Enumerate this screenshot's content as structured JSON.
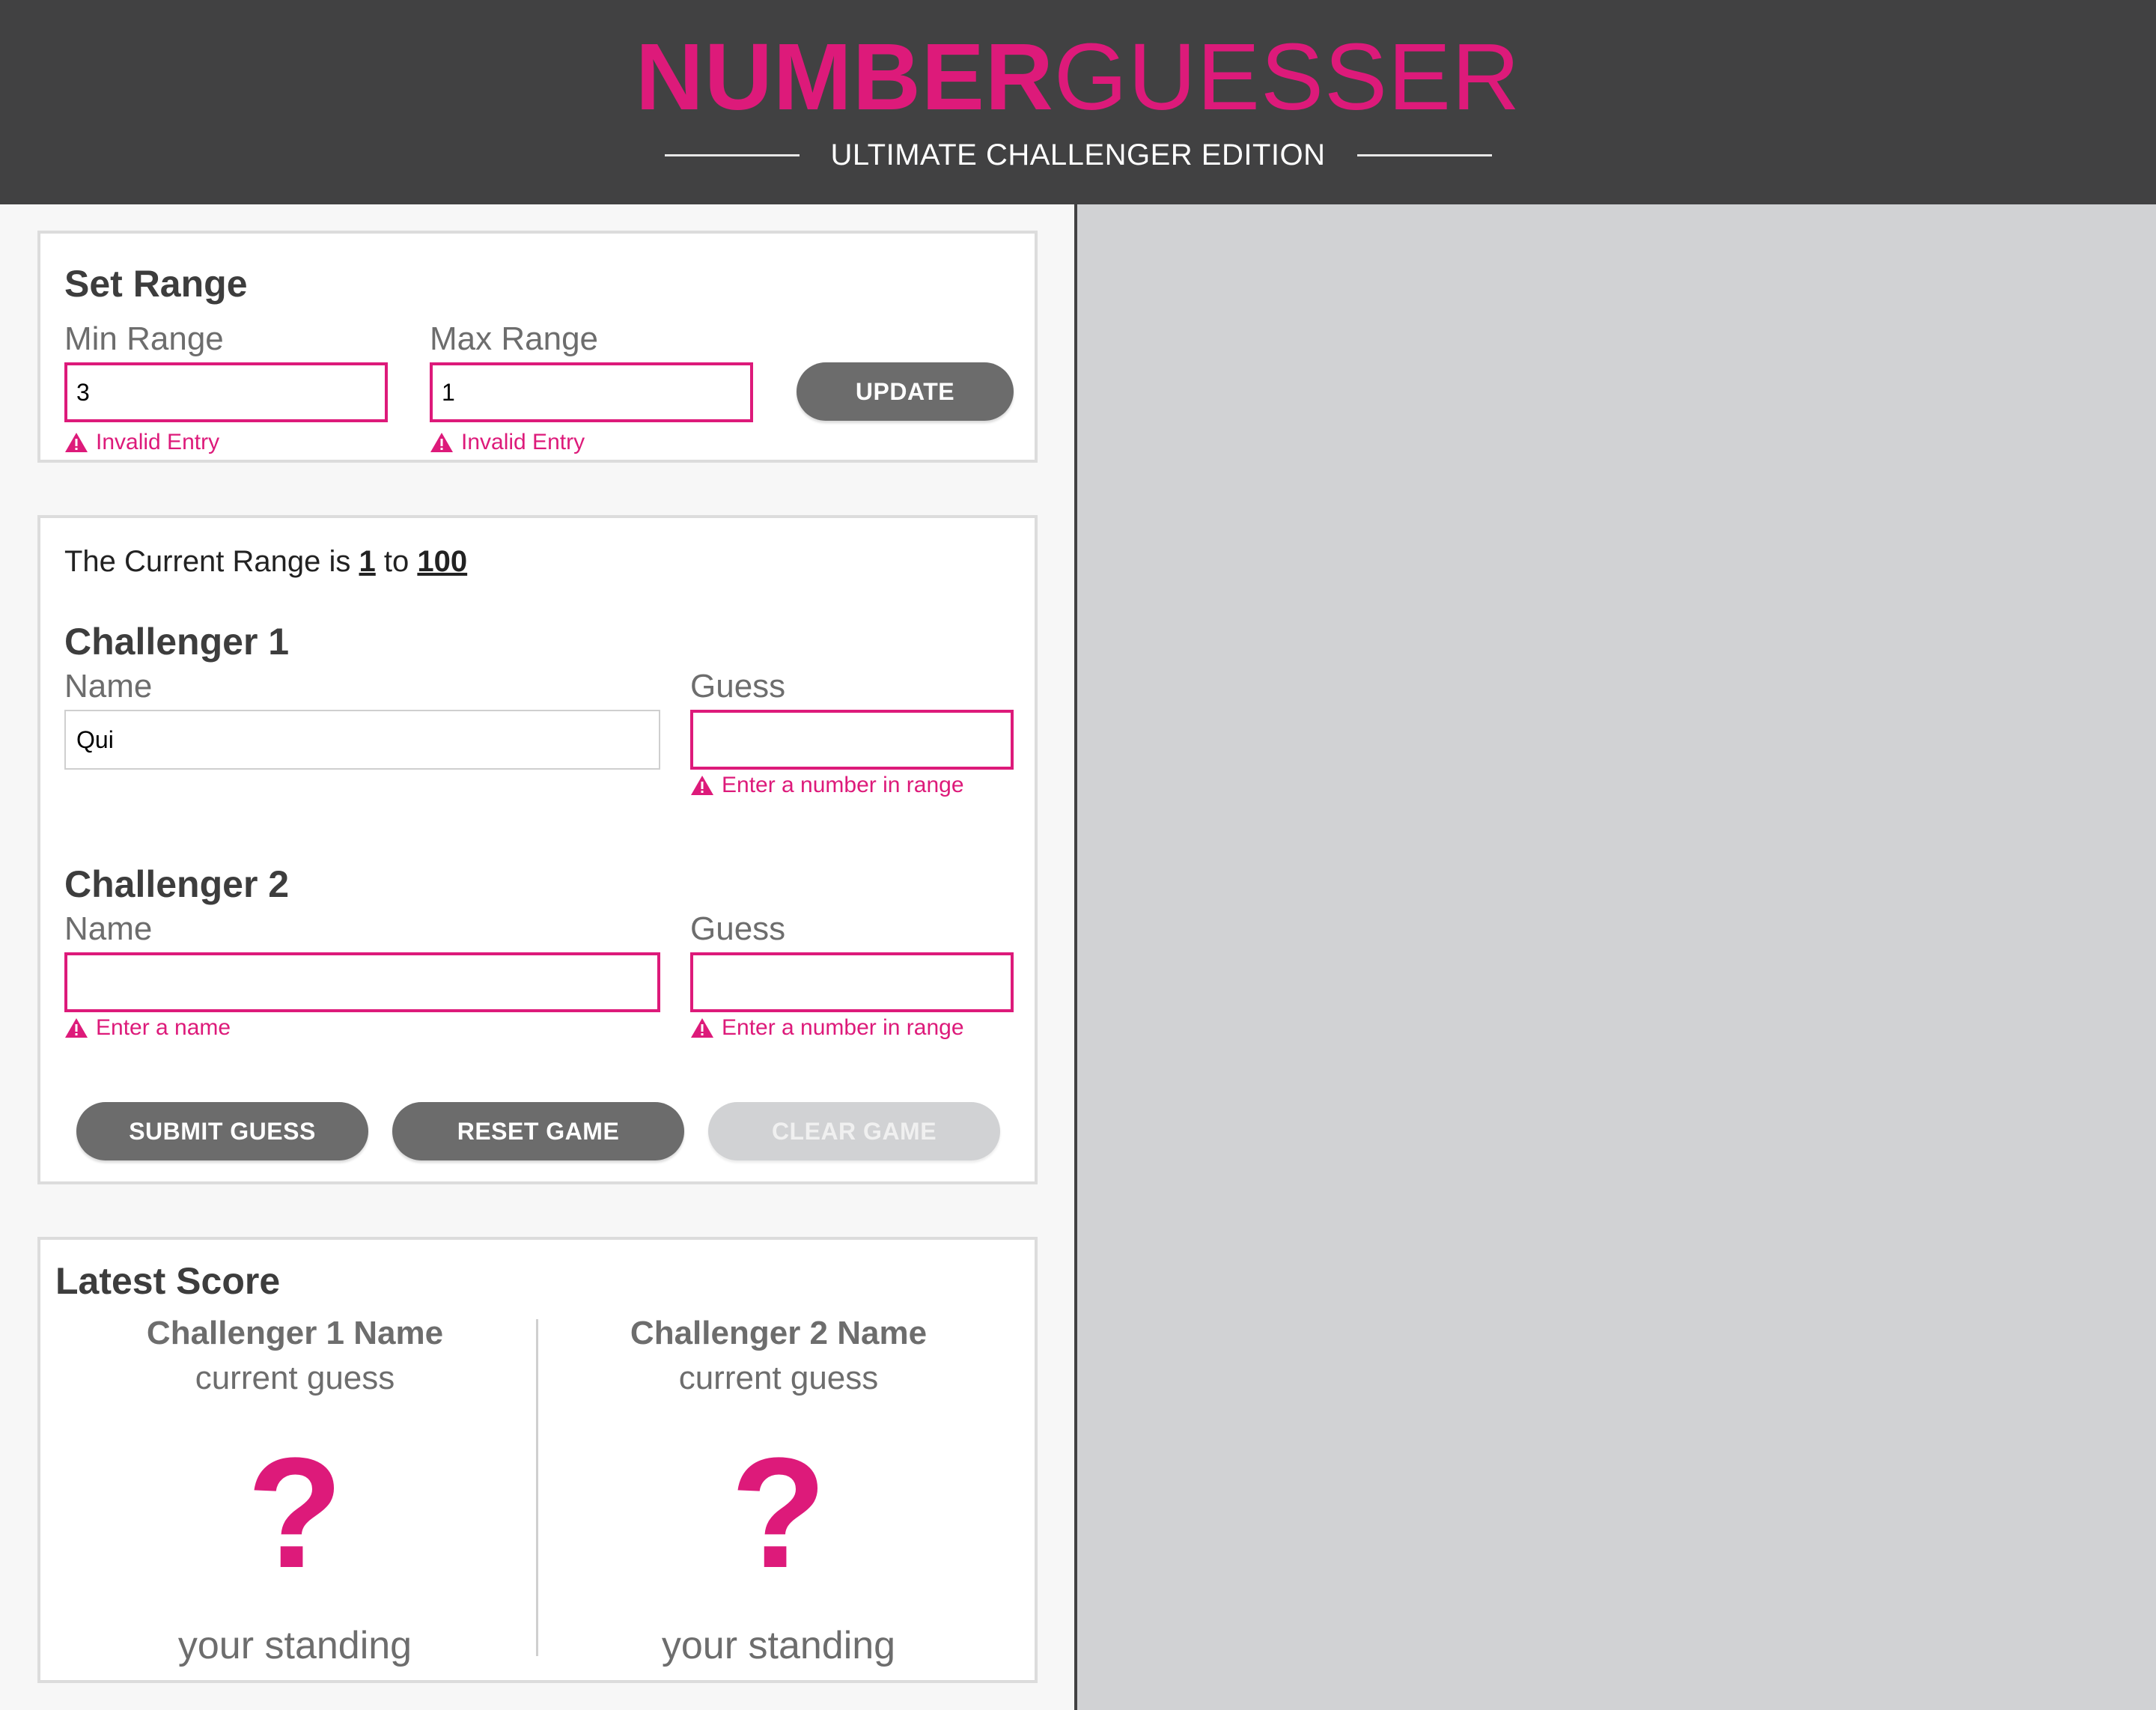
{
  "header": {
    "title_bold": "NUMBER",
    "title_light": "GUESSER",
    "subtitle": "ULTIMATE CHALLENGER EDITION"
  },
  "range_card": {
    "title": "Set Range",
    "min_label": "Min Range",
    "min_value": "3",
    "min_error": "Invalid Entry",
    "max_label": "Max Range",
    "max_value": "1",
    "max_error": "Invalid Entry",
    "update_label": "UPDATE"
  },
  "game_card": {
    "range_prefix": "The Current Range is",
    "range_min": "1",
    "range_to": "to",
    "range_max": "100",
    "challenger1": {
      "title": "Challenger 1",
      "name_label": "Name",
      "name_value": "Qui",
      "guess_label": "Guess",
      "guess_value": "",
      "guess_error": "Enter a number in range"
    },
    "challenger2": {
      "title": "Challenger 2",
      "name_label": "Name",
      "name_value": "",
      "name_error": "Enter a name",
      "guess_label": "Guess",
      "guess_value": "",
      "guess_error": "Enter a number in range"
    },
    "submit_label": "SUBMIT GUESS",
    "reset_label": "RESET GAME",
    "clear_label": "CLEAR GAME"
  },
  "score_card": {
    "title": "Latest Score",
    "p1_name": "Challenger 1 Name",
    "p1_sub": "current guess",
    "p1_guess": "?",
    "p1_standing": "your standing",
    "p2_name": "Challenger 2 Name",
    "p2_sub": "current guess",
    "p2_guess": "?",
    "p2_standing": "your standing"
  },
  "colors": {
    "accent": "#dd1a7a",
    "header_bg": "#414142",
    "button_bg": "#6c6c6c",
    "button_disabled_bg": "#d1d2d4",
    "right_panel_bg": "#d1d2d4"
  },
  "icons": {
    "warning": "warning-triangle-icon"
  }
}
